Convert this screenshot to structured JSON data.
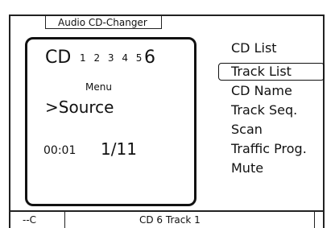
{
  "window": {
    "title": "Audio CD-Changer"
  },
  "lcd": {
    "cd_label": "CD",
    "disc_numbers": "1 2 3 4 5",
    "current_disc": "6",
    "menu_label": "Menu",
    "source_line": ">Source",
    "time": "00:01",
    "track": "1/11"
  },
  "menu": {
    "items": [
      {
        "label": "CD List"
      },
      {
        "label": "Track List"
      },
      {
        "label": "CD Name"
      },
      {
        "label": "Track Seq."
      },
      {
        "label": "Scan"
      },
      {
        "label": "Traffic Prog."
      },
      {
        "label": "Mute"
      }
    ],
    "selected_index": 1
  },
  "status": {
    "left": "--C",
    "center": "CD 6 Track 1"
  }
}
